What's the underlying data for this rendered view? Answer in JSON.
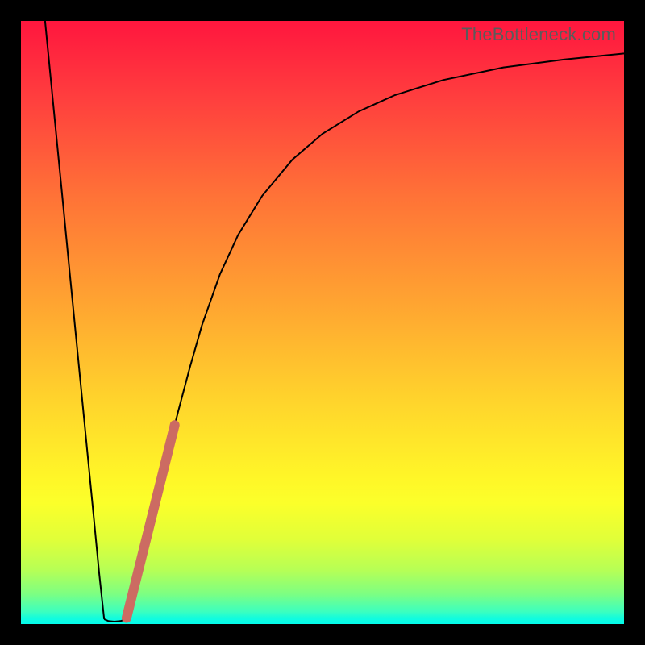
{
  "watermark": "TheBottleneck.com",
  "colors": {
    "frame": "#000000",
    "curve": "#000000",
    "overlay": "#cc6b62",
    "gradient_top": "#ff163e",
    "gradient_bottom": "#04fbeb"
  },
  "chart_data": {
    "type": "line",
    "title": "",
    "xlabel": "",
    "ylabel": "",
    "xlim": [
      0,
      100
    ],
    "ylim": [
      0,
      100
    ],
    "series": [
      {
        "name": "left-branch",
        "x": [
          4.0,
          5.0,
          6.0,
          7.0,
          8.0,
          9.0,
          10.0,
          11.0,
          12.0,
          13.0,
          13.8
        ],
        "y": [
          100.0,
          89.8,
          79.6,
          69.4,
          59.2,
          49.0,
          38.8,
          28.6,
          18.4,
          8.2,
          0.8
        ]
      },
      {
        "name": "valley-floor",
        "x": [
          13.8,
          14.5,
          15.5,
          16.5,
          17.5,
          18.0
        ],
        "y": [
          0.8,
          0.5,
          0.4,
          0.5,
          0.8,
          1.2
        ]
      },
      {
        "name": "right-branch",
        "x": [
          18.0,
          20.0,
          22.0,
          24.0,
          26.0,
          28.0,
          30.0,
          33.0,
          36.0,
          40.0,
          45.0,
          50.0,
          56.0,
          62.0,
          70.0,
          80.0,
          90.0,
          100.0
        ],
        "y": [
          1.2,
          9.0,
          18.0,
          27.0,
          35.0,
          42.5,
          49.5,
          58.0,
          64.5,
          71.0,
          77.0,
          81.3,
          85.0,
          87.7,
          90.2,
          92.3,
          93.6,
          94.6
        ]
      }
    ],
    "overlay_segment": {
      "name": "highlight-band",
      "x_start": 17.5,
      "y_start": 1.0,
      "x_end": 25.5,
      "y_end": 33.0
    }
  }
}
